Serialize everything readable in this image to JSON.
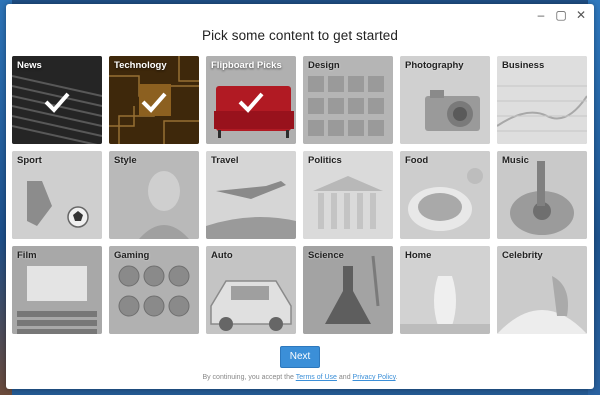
{
  "window": {
    "controls": {
      "minimize": "–",
      "maximize": "▢",
      "close": "✕"
    }
  },
  "heading": "Pick some content to get started",
  "tiles": [
    {
      "label": "News",
      "selected": true
    },
    {
      "label": "Technology",
      "selected": true
    },
    {
      "label": "Flipboard Picks",
      "selected": true
    },
    {
      "label": "Design",
      "selected": false
    },
    {
      "label": "Photography",
      "selected": false
    },
    {
      "label": "Business",
      "selected": false
    },
    {
      "label": "Sport",
      "selected": false
    },
    {
      "label": "Style",
      "selected": false
    },
    {
      "label": "Travel",
      "selected": false
    },
    {
      "label": "Politics",
      "selected": false
    },
    {
      "label": "Food",
      "selected": false
    },
    {
      "label": "Music",
      "selected": false
    },
    {
      "label": "Film",
      "selected": false
    },
    {
      "label": "Gaming",
      "selected": false
    },
    {
      "label": "Auto",
      "selected": false
    },
    {
      "label": "Science",
      "selected": false
    },
    {
      "label": "Home",
      "selected": false
    },
    {
      "label": "Celebrity",
      "selected": false
    }
  ],
  "next_button": "Next",
  "footer": {
    "prefix": "By continuing, you accept the",
    "terms": "Terms of Use",
    "and": "and",
    "privacy": "Privacy Policy",
    "suffix": "."
  },
  "colors": {
    "accent": "#3b8fd8"
  }
}
